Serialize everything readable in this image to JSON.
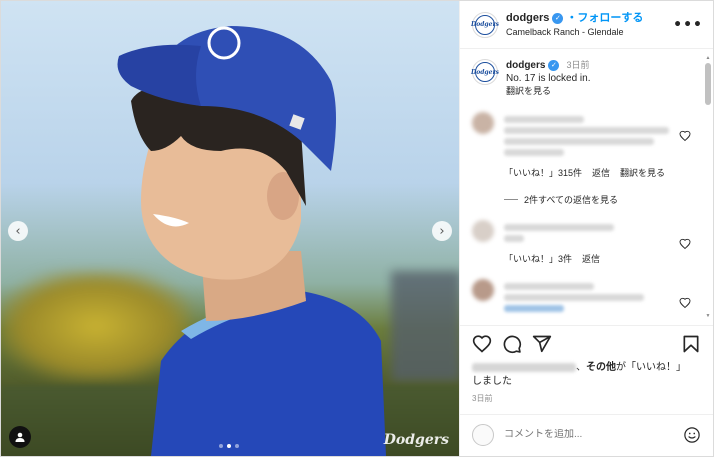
{
  "post": {
    "username": "dodgers",
    "follow_label": "・フォローする",
    "location": "Camelback Ranch - Glendale",
    "more_label": "•••",
    "watermark": "Dodgers",
    "logo_text": "Dodgers"
  },
  "caption": {
    "username": "dodgers",
    "time": "3日前",
    "text": "No. 17 is locked in.",
    "translate": "翻訳を見る"
  },
  "comments": [
    {
      "likes": "「いいね！」315件",
      "reply": "返信",
      "translate": "翻訳を見る"
    },
    {
      "likes": "「いいね！」3件",
      "reply": "返信"
    }
  ],
  "replies_toggle": "2件すべての返信を見る",
  "likes_summary": {
    "sep": "、",
    "others": "その他",
    "suffix": "が「いいね！」",
    "line2": "しました"
  },
  "date": "3日前",
  "add_comment": {
    "placeholder": "コメントを追加..."
  },
  "carousel": {
    "current": 2,
    "total": 3
  },
  "icons": {
    "like": "heart-icon",
    "comment": "comment-icon",
    "share": "share-icon",
    "save": "bookmark-icon",
    "emoji": "emoji-icon",
    "prev": "chevron-left-icon",
    "next": "chevron-right-icon",
    "tags": "user-tag-icon",
    "verified": "verified-icon"
  },
  "colors": {
    "follow": "#0095f6",
    "verified": "#3897f0",
    "brand": "#1d4f9e"
  }
}
